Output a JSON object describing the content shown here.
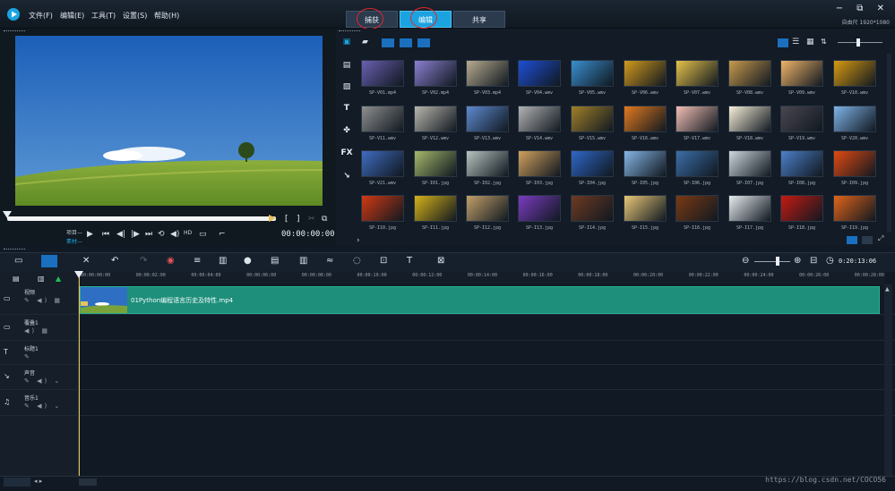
{
  "menu": [
    "文件(F)",
    "编辑(E)",
    "工具(T)",
    "设置(S)",
    "帮助(H)"
  ],
  "stage_tabs": [
    {
      "label": "捕获",
      "active": false
    },
    {
      "label": "编辑",
      "active": true
    },
    {
      "label": "共享",
      "active": false
    }
  ],
  "window": {
    "resolution": "自由尺 1920*1080",
    "controls": "− ⧉ ✕"
  },
  "player": {
    "mode_project": "项目—",
    "mode_clip": "素材—",
    "timecode": "00:00:00:00",
    "bracket_in": "[",
    "bracket_out": "]"
  },
  "library": {
    "thumbnails": [
      {
        "caption": "SP-V01.mp4",
        "color": "#6a5fb2"
      },
      {
        "caption": "SP-V02.mp4",
        "color": "#8b7fd1"
      },
      {
        "caption": "SP-V03.mp4",
        "color": "#b8ab90"
      },
      {
        "caption": "SP-V04.wmv",
        "color": "#1e4fd6"
      },
      {
        "caption": "SP-V05.wmv",
        "color": "#3a8fd0"
      },
      {
        "caption": "SP-V06.wmv",
        "color": "#d29a1c"
      },
      {
        "caption": "SP-V07.wmv",
        "color": "#e6c24a"
      },
      {
        "caption": "SP-V08.wmv",
        "color": "#c79a4e"
      },
      {
        "caption": "SP-V09.wmv",
        "color": "#f0b468"
      },
      {
        "caption": "SP-V10.wmv",
        "color": "#d79a12"
      },
      {
        "caption": "SP-V11.wmv",
        "color": "#8f8f8f"
      },
      {
        "caption": "SP-V12.wmv",
        "color": "#b9b6ac"
      },
      {
        "caption": "SP-V13.wmv",
        "color": "#5e8ad0"
      },
      {
        "caption": "SP-V14.wmv",
        "color": "#b3b3b3"
      },
      {
        "caption": "SP-V15.wmv",
        "color": "#a0802a"
      },
      {
        "caption": "SP-V16.wmv",
        "color": "#e27a1e"
      },
      {
        "caption": "SP-V17.wmv",
        "color": "#f2bfb4"
      },
      {
        "caption": "SP-V18.wmv",
        "color": "#f7efd8"
      },
      {
        "caption": "SP-V19.wmv",
        "color": "#4a4650"
      },
      {
        "caption": "SP-V20.wmv",
        "color": "#7fb4e8"
      },
      {
        "caption": "SP-V21.wmv",
        "color": "#3f6cc0"
      },
      {
        "caption": "SP-I01.jpg",
        "color": "#a6b86a"
      },
      {
        "caption": "SP-I02.jpg",
        "color": "#b8c4bf"
      },
      {
        "caption": "SP-I03.jpg",
        "color": "#d2a15e"
      },
      {
        "caption": "SP-I04.jpg",
        "color": "#2f67c8"
      },
      {
        "caption": "SP-I05.jpg",
        "color": "#86b6e6"
      },
      {
        "caption": "SP-I06.jpg",
        "color": "#3c6ea8"
      },
      {
        "caption": "SP-I07.jpg",
        "color": "#cfd7de"
      },
      {
        "caption": "SP-I08.jpg",
        "color": "#4c7fc8"
      },
      {
        "caption": "SP-I09.jpg",
        "color": "#e24a12"
      },
      {
        "caption": "SP-I10.jpg",
        "color": "#d13a12"
      },
      {
        "caption": "SP-I11.jpg",
        "color": "#d6b21a"
      },
      {
        "caption": "SP-I12.jpg",
        "color": "#c2a06a"
      },
      {
        "caption": "SP-I13.jpg",
        "color": "#7a3cc0"
      },
      {
        "caption": "SP-I14.jpg",
        "color": "#6e3a22"
      },
      {
        "caption": "SP-I15.jpg",
        "color": "#e8c878"
      },
      {
        "caption": "SP-I16.jpg",
        "color": "#7a3a14"
      },
      {
        "caption": "SP-I17.jpg",
        "color": "#e8ecf0"
      },
      {
        "caption": "SP-I18.jpg",
        "color": "#c51a12"
      },
      {
        "caption": "SP-I19.jpg",
        "color": "#e0641a"
      }
    ]
  },
  "timeline": {
    "ruler_labels": [
      "00:00:00:00",
      "00:00:02:00",
      "00:00:04:00",
      "00:00:06:00",
      "00:00:08:00",
      "00:00:10:00",
      "00:00:12:00",
      "00:00:14:00",
      "00:00:16:00",
      "00:00:18:00",
      "00:00:20:00",
      "00:00:22:00",
      "00:00:24:00",
      "00:00:26:00",
      "00:00:28:00",
      "00:00:30:0"
    ],
    "zoom_timecode": "0:20:13:06",
    "tracks": [
      {
        "name": "视频",
        "icons": "✎ ◀) ▦"
      },
      {
        "name": "覆叠1",
        "icons": "◀) ▦"
      },
      {
        "name": "标题1",
        "icons": "✎"
      },
      {
        "name": "声音",
        "icons": "✎ ◀) ⌄"
      },
      {
        "name": "音乐1",
        "icons": "✎ ◀) ⌄"
      }
    ],
    "clip_label": "01Python编程语言历史及特性.mp4"
  },
  "watermark": "https://blog.csdn.net/COCO56",
  "colors": {
    "accent": "#1aa3e0",
    "clip": "#1e8f7a",
    "annotation": "#e02828"
  }
}
